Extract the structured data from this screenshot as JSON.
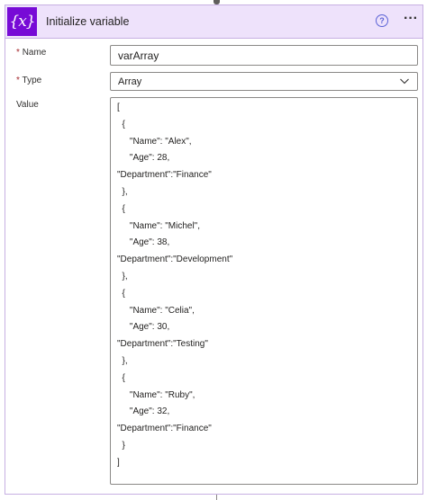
{
  "header": {
    "icon_text": "{x}",
    "title": "Initialize variable",
    "help_icon": "help-circle-icon",
    "more_icon": "more-options-icon"
  },
  "fields": {
    "name": {
      "label": "Name",
      "required_mark": "*",
      "value": "varArray"
    },
    "type": {
      "label": "Type",
      "required_mark": "*",
      "value": "Array"
    },
    "value": {
      "label": "Value"
    }
  },
  "value_lines": [
    "[",
    "  {",
    "     \"Name\": \"Alex\",",
    "     \"Age\": 28,",
    "\"Department\":\"Finance\"",
    "  },",
    "  {",
    "     \"Name\": \"Michel\",",
    "     \"Age\": 38,",
    "\"Department\":\"Development\"",
    "  },",
    "  {",
    "     \"Name\": \"Celia\",",
    "     \"Age\": 30,",
    "\"Department\":\"Testing\"",
    "  },",
    "  {",
    "     \"Name\": \"Ruby\",",
    "     \"Age\": 32,",
    "\"Department\":\"Finance\"",
    "  }",
    "]"
  ],
  "colors": {
    "accent": "#770bd6",
    "header_bg": "#eee2fb",
    "border": "#c7b0e2",
    "required": "#a4262c",
    "help": "#5a62d6"
  }
}
